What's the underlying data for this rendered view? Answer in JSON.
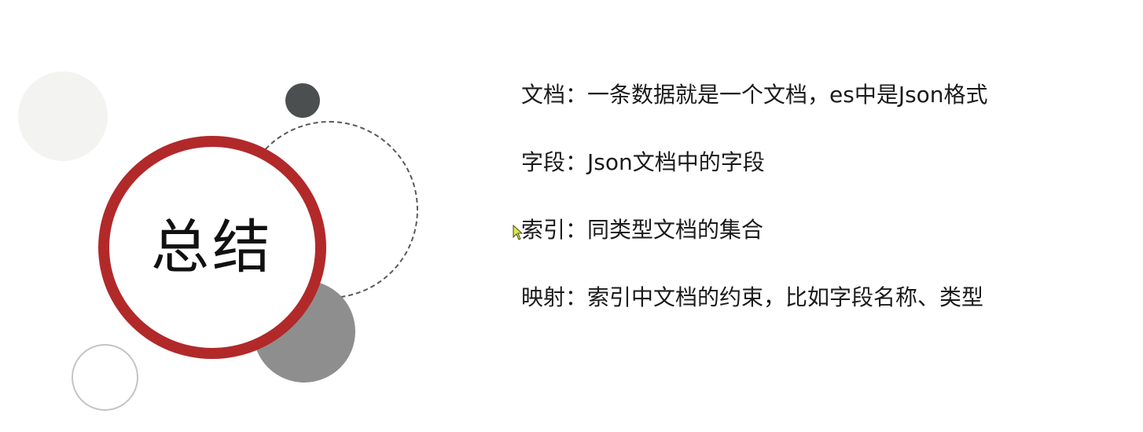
{
  "slide": {
    "title": "总结",
    "items": [
      "文档：一条数据就是一个文档，es中是Json格式",
      "字段：Json文档中的字段",
      "索引：同类型文档的集合",
      "映射：索引中文档的约束，比如字段名称、类型"
    ]
  },
  "colors": {
    "accent_red": "#b2292a",
    "dark_gray": "#4b4f4f",
    "mid_gray": "#8e8e8f",
    "light_gray": "#f3f3f2",
    "outline_gray": "#c4c4c4"
  },
  "icons": {
    "cursor": "mouse-pointer-icon"
  }
}
